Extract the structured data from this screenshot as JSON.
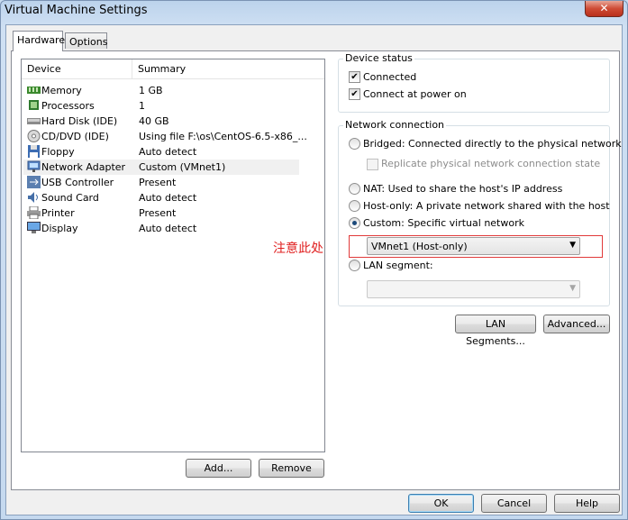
{
  "window": {
    "title": "Virtual Machine Settings",
    "close_glyph": "✕"
  },
  "tabs": [
    {
      "label": "Hardware"
    },
    {
      "label": "Options"
    }
  ],
  "device_list": {
    "columns": {
      "device": "Device",
      "summary": "Summary"
    },
    "rows": [
      {
        "device": "Memory",
        "summary": "1 GB",
        "icon": "memory-icon"
      },
      {
        "device": "Processors",
        "summary": "1",
        "icon": "processor-icon"
      },
      {
        "device": "Hard Disk (IDE)",
        "summary": "40 GB",
        "icon": "hard-disk-icon"
      },
      {
        "device": "CD/DVD (IDE)",
        "summary": "Using file F:\\os\\CentOS-6.5-x86_...",
        "icon": "cd-dvd-icon"
      },
      {
        "device": "Floppy",
        "summary": "Auto detect",
        "icon": "floppy-icon"
      },
      {
        "device": "Network Adapter",
        "summary": "Custom (VMnet1)",
        "icon": "network-adapter-icon",
        "selected": true
      },
      {
        "device": "USB Controller",
        "summary": "Present",
        "icon": "usb-icon"
      },
      {
        "device": "Sound Card",
        "summary": "Auto detect",
        "icon": "sound-icon"
      },
      {
        "device": "Printer",
        "summary": "Present",
        "icon": "printer-icon"
      },
      {
        "device": "Display",
        "summary": "Auto detect",
        "icon": "display-icon"
      }
    ]
  },
  "buttons": {
    "add": "Add...",
    "remove": "Remove",
    "lan_segments": "LAN Segments...",
    "advanced": "Advanced...",
    "ok": "OK",
    "cancel": "Cancel",
    "help": "Help"
  },
  "device_status": {
    "legend": "Device status",
    "connected": {
      "label": "Connected",
      "checked": true
    },
    "connect_at_power_on": {
      "label": "Connect at power on",
      "checked": true
    }
  },
  "network_connection": {
    "legend": "Network connection",
    "bridged": "Bridged: Connected directly to the physical network",
    "replicate": "Replicate physical network connection state",
    "nat": "NAT: Used to share the host's IP address",
    "host_only": "Host-only: A private network shared with the host",
    "custom": "Custom: Specific virtual network",
    "custom_value": "VMnet1 (Host-only)",
    "lan_segment": "LAN segment:",
    "selected": "custom"
  },
  "annotation": {
    "text": "注意此处",
    "color": "#e02020"
  },
  "colors": {
    "check": "✔",
    "dropdown": "▼"
  }
}
